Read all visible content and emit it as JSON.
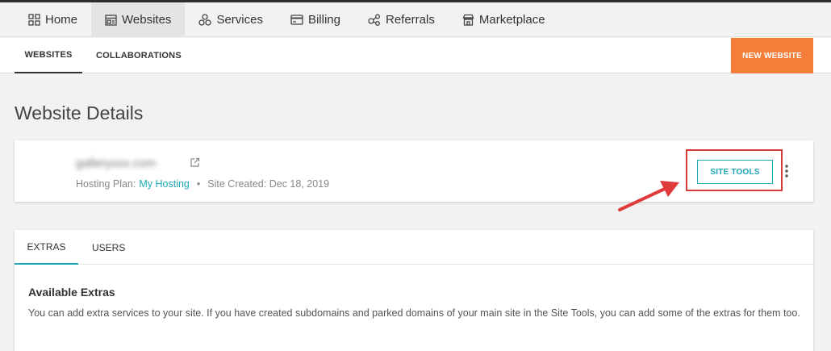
{
  "topnav": {
    "items": [
      {
        "label": "Home",
        "icon": "grid-icon"
      },
      {
        "label": "Websites",
        "icon": "window-icon",
        "active": true
      },
      {
        "label": "Services",
        "icon": "services-icon"
      },
      {
        "label": "Billing",
        "icon": "credit-card-icon"
      },
      {
        "label": "Referrals",
        "icon": "share-icon"
      },
      {
        "label": "Marketplace",
        "icon": "store-icon"
      }
    ]
  },
  "subnav": {
    "tabs": [
      "WEBSITES",
      "COLLABORATIONS"
    ],
    "new_website_label": "NEW WEBSITE"
  },
  "page": {
    "title": "Website Details"
  },
  "site": {
    "domain": "galleryxxx.com",
    "hosting_plan_label": "Hosting Plan:",
    "hosting_plan_value": "My Hosting",
    "created": "Site Created: Dec 18, 2019",
    "site_tools_label": "SITE TOOLS"
  },
  "extras": {
    "tabs": [
      "EXTRAS",
      "USERS"
    ],
    "title": "Available Extras",
    "description": "You can add extra services to your site. If you have created subdomains and parked domains of your main site in the Site Tools, you can add some of the extras for them too."
  },
  "colors": {
    "accent": "#1ea7b5",
    "new_button": "#f47d3a",
    "highlight": "#d43a3a"
  }
}
